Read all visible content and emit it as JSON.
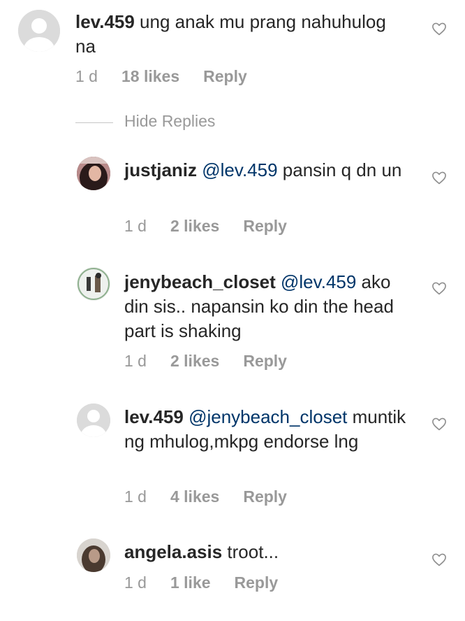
{
  "comments": [
    {
      "username": "lev.459",
      "mention": "",
      "text": " ung anak mu prang nahuhulog na",
      "time": "1 d",
      "likes": "18 likes",
      "reply": "Reply",
      "avatar": "default-avatar"
    },
    {
      "username": "justjaniz",
      "mention": "@lev.459",
      "text": " pansin q dn un",
      "time": "1 d",
      "likes": "2 likes",
      "reply": "Reply",
      "avatar": "photo-avatar"
    },
    {
      "username": "jenybeach_closet",
      "mention": "@lev.459",
      "text": " ako din sis.. napansin ko din the head part is shaking",
      "time": "1 d",
      "likes": "2 likes",
      "reply": "Reply",
      "avatar": "photo-avatar"
    },
    {
      "username": "lev.459",
      "mention": "@jenybeach_closet",
      "text": " muntik ng mhulog,mkpg endorse lng",
      "time": "1 d",
      "likes": "4 likes",
      "reply": "Reply",
      "avatar": "default-avatar"
    },
    {
      "username": "angela.asis",
      "mention": "",
      "text": " troot...",
      "time": "1 d",
      "likes": "1 like",
      "reply": "Reply",
      "avatar": "photo-avatar"
    }
  ],
  "hide_replies_label": "Hide Replies",
  "icons": {
    "like": "heart-outline-icon",
    "avatar": "default-avatar"
  },
  "colors": {
    "text": "#262626",
    "meta": "#999999",
    "mention": "#003569"
  }
}
